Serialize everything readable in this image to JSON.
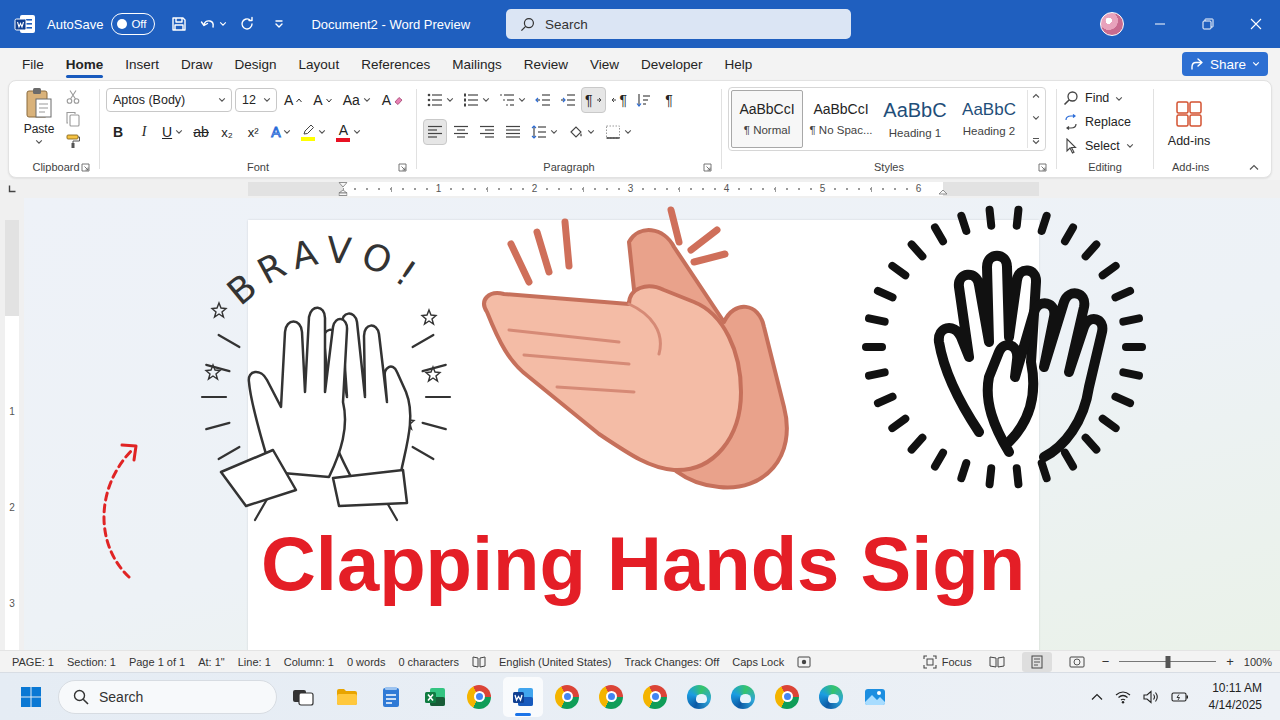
{
  "window": {
    "title": "Document2 - Word Preview",
    "autosave": {
      "label": "AutoSave",
      "state": "Off",
      "on": false
    }
  },
  "search": {
    "placeholder": "Search"
  },
  "tabs": [
    {
      "label": "File",
      "selected": false
    },
    {
      "label": "Home",
      "selected": true
    },
    {
      "label": "Insert",
      "selected": false
    },
    {
      "label": "Draw",
      "selected": false
    },
    {
      "label": "Design",
      "selected": false
    },
    {
      "label": "Layout",
      "selected": false
    },
    {
      "label": "References",
      "selected": false
    },
    {
      "label": "Mailings",
      "selected": false
    },
    {
      "label": "Review",
      "selected": false
    },
    {
      "label": "View",
      "selected": false
    },
    {
      "label": "Developer",
      "selected": false
    },
    {
      "label": "Help",
      "selected": false
    }
  ],
  "share": {
    "label": "Share"
  },
  "ribbon": {
    "clipboard": {
      "label": "Clipboard",
      "paste": "Paste"
    },
    "font": {
      "label": "Font",
      "name": "Aptos (Body)",
      "size": "12",
      "row1": [
        {
          "kind": "grow",
          "label": "A"
        },
        {
          "kind": "shrink",
          "label": "A"
        },
        {
          "kind": "case",
          "label": "Aa"
        },
        {
          "kind": "clear",
          "label": "A"
        }
      ],
      "row2": [
        {
          "kind": "bold",
          "label": "B",
          "dropdown": false
        },
        {
          "kind": "italic",
          "label": "I",
          "dropdown": false
        },
        {
          "kind": "underline",
          "label": "U",
          "dropdown": true
        },
        {
          "kind": "strike",
          "label": "ab",
          "dropdown": false
        },
        {
          "kind": "subscript",
          "label": "x₂",
          "dropdown": false
        },
        {
          "kind": "superscript",
          "label": "x²",
          "dropdown": false
        },
        {
          "kind": "effects",
          "label": "A",
          "dropdown": true
        },
        {
          "kind": "highlight",
          "dropdown": true,
          "color": "#ffff00"
        },
        {
          "kind": "color",
          "label": "A",
          "dropdown": true,
          "color": "#e81123"
        }
      ]
    },
    "paragraph": {
      "label": "Paragraph",
      "row1": [
        {
          "kind": "bullets",
          "dropdown": true,
          "selected": false
        },
        {
          "kind": "numbering",
          "dropdown": true,
          "selected": false
        },
        {
          "kind": "multilevel",
          "dropdown": true,
          "selected": false
        },
        {
          "kind": "outdent",
          "dropdown": false,
          "selected": false
        },
        {
          "kind": "indent",
          "dropdown": false,
          "selected": false
        },
        {
          "kind": "ltr",
          "label": "¶",
          "dropdown": false,
          "selected": true
        },
        {
          "kind": "rtl",
          "label": "¶",
          "dropdown": false,
          "selected": false
        },
        {
          "kind": "sort",
          "dropdown": false,
          "selected": false
        },
        {
          "kind": "marks",
          "label": "¶",
          "dropdown": false,
          "selected": false
        }
      ],
      "row2": [
        {
          "kind": "align-left",
          "dropdown": false,
          "selected": true
        },
        {
          "kind": "align-center",
          "dropdown": false,
          "selected": false
        },
        {
          "kind": "align-right",
          "dropdown": false,
          "selected": false
        },
        {
          "kind": "justify",
          "dropdown": false,
          "selected": false
        },
        {
          "kind": "spacing",
          "dropdown": true,
          "selected": false
        },
        {
          "kind": "shading",
          "dropdown": true,
          "selected": false
        },
        {
          "kind": "borders",
          "dropdown": true,
          "selected": false
        }
      ]
    },
    "styles": {
      "label": "Styles",
      "items": [
        {
          "preview": "AaBbCcI",
          "name": "¶ Normal",
          "kind": "body",
          "selected": true
        },
        {
          "preview": "AaBbCcI",
          "name": "¶ No Spac...",
          "kind": "body",
          "selected": false
        },
        {
          "preview": "AaBbC",
          "name": "Heading 1",
          "kind": "heading1",
          "selected": false
        },
        {
          "preview": "AaBbC",
          "name": "Heading 2",
          "kind": "heading2",
          "selected": false
        }
      ]
    },
    "editing": {
      "label": "Editing",
      "items": [
        {
          "kind": "find",
          "label": "Find",
          "dropdown": true
        },
        {
          "kind": "replace",
          "label": "Replace",
          "dropdown": false
        },
        {
          "kind": "select",
          "label": "Select",
          "dropdown": true
        }
      ]
    },
    "addins": {
      "label": "Add-ins",
      "button": "Add-ins"
    }
  },
  "ruler": {
    "horizontal": [
      "1",
      "2",
      "3",
      "4",
      "5",
      "6"
    ],
    "vertical": [
      "1",
      "2",
      "3"
    ]
  },
  "document": {
    "images": [
      {
        "kind": "line-art",
        "caption": "BRAVO!"
      },
      {
        "kind": "color"
      },
      {
        "kind": "icon"
      }
    ],
    "title": "Clapping Hands Sign"
  },
  "status_bar": {
    "items": [
      "PAGE: 1",
      "Section: 1",
      "Page 1 of 1",
      "At: 1\"",
      "Line: 1",
      "Column: 1",
      "0 words",
      "0 characters"
    ],
    "language": "English (United States)",
    "track_changes": "Track Changes: Off",
    "caps_lock": "Caps Lock",
    "focus": "Focus",
    "views": [
      {
        "kind": "read",
        "selected": false
      },
      {
        "kind": "print",
        "selected": true
      },
      {
        "kind": "web",
        "selected": false
      }
    ],
    "zoom": {
      "minus": "−",
      "plus": "+",
      "level": 0.5,
      "reading": "100%"
    }
  },
  "taskbar": {
    "search": "Search",
    "apps": [
      {
        "kind": "taskview",
        "active": false
      },
      {
        "kind": "explorer",
        "active": false
      },
      {
        "kind": "notepad",
        "active": false
      },
      {
        "kind": "excel",
        "active": false
      },
      {
        "kind": "chrome",
        "active": false
      },
      {
        "kind": "word",
        "active": true
      },
      {
        "kind": "chrome",
        "active": false
      },
      {
        "kind": "chrome",
        "active": false
      },
      {
        "kind": "chrome",
        "active": false
      },
      {
        "kind": "edge",
        "active": false
      },
      {
        "kind": "edge",
        "active": false
      },
      {
        "kind": "chrome",
        "active": false
      },
      {
        "kind": "edge",
        "active": false
      },
      {
        "kind": "photos",
        "active": false
      }
    ],
    "clock": {
      "time": "10:11 AM",
      "date": "4/14/2025"
    }
  }
}
